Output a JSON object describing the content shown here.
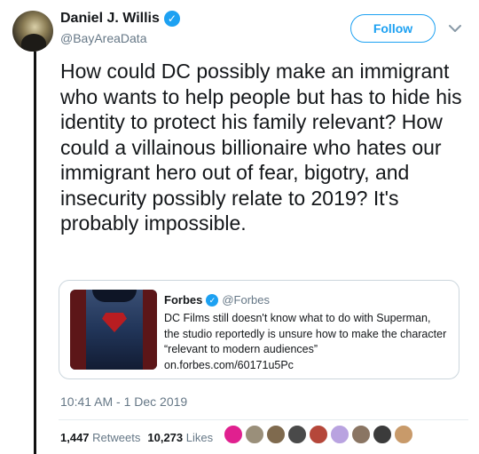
{
  "author": {
    "display_name": "Daniel J. Willis",
    "handle": "@BayAreaData",
    "verified_icon": "verified-badge-icon"
  },
  "follow_label": "Follow",
  "tweet": {
    "text": "How could DC possibly make an immigrant who wants to help people but has to hide his identity to protect his family relevant? How could a villainous billionaire who hates our immigrant hero out of fear, bigotry, and insecurity possibly relate to 2019? It's probably impossible.",
    "timestamp": "10:41 AM - 1 Dec 2019"
  },
  "quoted": {
    "name": "Forbes",
    "handle": "@Forbes",
    "text": "DC Films still doesn't know what to do with Superman, the studio reportedly is unsure how to make the character “relevant to modern audiences” on.forbes.com/60171u5Pc"
  },
  "stats": {
    "retweets_count": "1,447",
    "retweets_label": "Retweets",
    "likes_count": "10,273",
    "likes_label": "Likes"
  },
  "liker_avatars": [
    {
      "color": "#e0208f"
    },
    {
      "color": "#9a8f7a"
    },
    {
      "color": "#7f6a4e"
    },
    {
      "color": "#4a4a4a"
    },
    {
      "color": "#b5473a"
    },
    {
      "color": "#b9a3e0"
    },
    {
      "color": "#8a7563"
    },
    {
      "color": "#3b3b3b"
    },
    {
      "color": "#c89a6a"
    }
  ],
  "colors": {
    "accent": "#1da1f2",
    "muted": "#657786",
    "text": "#14171a"
  }
}
